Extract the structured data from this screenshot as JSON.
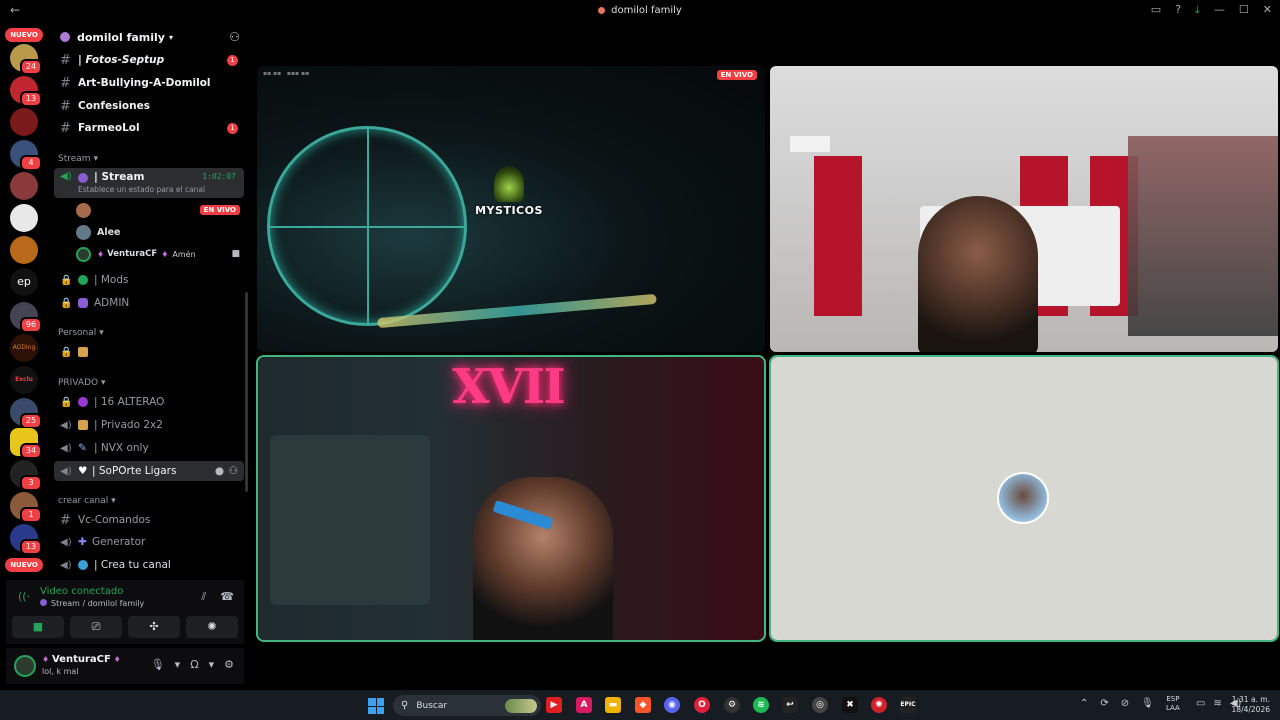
{
  "window": {
    "title": "domilol family",
    "back_glyph": "←"
  },
  "rail": {
    "new_label": "NUEVO",
    "ep_label": "ep",
    "badges": [
      "24",
      "13",
      "4",
      "96",
      "AODing",
      "Exclu",
      "25",
      "34",
      "3",
      "1",
      "13"
    ]
  },
  "server": {
    "name": "domilol family"
  },
  "channels": {
    "fotos": "| Fotos-Septup",
    "fotos_count": "1",
    "art": "Art-Bullying-A-Domilol",
    "confesiones": "Confesiones",
    "farmeo": "FarmeoLol",
    "farmeo_count": "1"
  },
  "stream_cat": {
    "label": "Stream",
    "channel": "| Stream",
    "timer": "1:02:07",
    "status_hint": "Establece un estado para el canal",
    "live_label": "EN VIVO",
    "users": [
      "Alee",
      "VenturaCF"
    ],
    "amen": "Amén"
  },
  "more_channels": {
    "mods": "| Mods",
    "admin": "ADMIN"
  },
  "personal_cat": {
    "label": "Personal"
  },
  "privado_cat": {
    "label": "PRIVADO",
    "items": [
      "| 16 ALTERAO",
      "| Privado 2x2",
      "| NVX only",
      "| SoPOrte Ligars"
    ]
  },
  "crear_cat": {
    "label": "crear canal",
    "items": [
      "Vc-Comandos",
      "Generator",
      "| Crea tu canal"
    ]
  },
  "voice_panel": {
    "connected": "Video conectado",
    "location": "Stream / domilol family"
  },
  "user": {
    "name": "VenturaCF",
    "status": "lol, k mal"
  },
  "streams": {
    "live_tag": "EN VIVO",
    "logo_text": "MYSTICOS",
    "neon_text": "XVII"
  },
  "taskbar": {
    "search_placeholder": "Buscar",
    "lang_top": "ESP",
    "lang_bottom": "LAA",
    "time": "1:31 a. m.",
    "date": "18/4/2026"
  },
  "colors": {
    "accent_green": "#23a559",
    "speaking_outline": "#43b581",
    "badge_red": "#f23f43"
  }
}
